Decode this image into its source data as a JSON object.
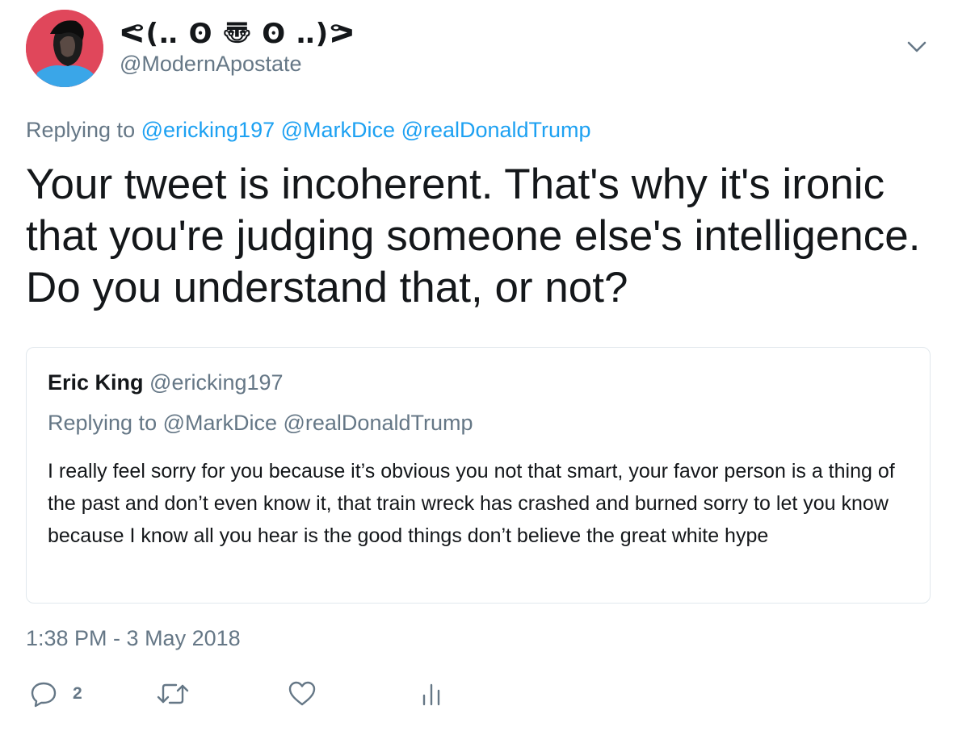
{
  "author": {
    "display_name": "ᕙ(‥ ʘ 〠 ʘ ‥)ᕗ",
    "handle": "@ModernApostate"
  },
  "reply_context": {
    "prefix": "Replying to",
    "mentions": [
      "@ericking197",
      "@MarkDice",
      "@realDonaldTrump"
    ]
  },
  "tweet_text": "Your tweet is incoherent. That's why it's ironic that you're judging someone else's intelligence. Do you understand that, or not?",
  "quoted_tweet": {
    "name": "Eric King",
    "handle": "@ericking197",
    "reply_context": "Replying to @MarkDice @realDonaldTrump",
    "text": "I really feel sorry for you because it’s obvious you not that smart, your favor person is a thing of the past and don’t even know it, that train wreck has crashed and burned sorry to let you know because I know all you hear is the good things don’t believe the great white hype"
  },
  "timestamp": "1:38 PM - 3 May 2018",
  "actions": {
    "reply_count": "2",
    "reply_icon": "reply-icon",
    "retweet_icon": "retweet-icon",
    "like_icon": "heart-icon",
    "analytics_icon": "analytics-icon"
  },
  "colors": {
    "link": "#1da1f2",
    "secondary_text": "#657786",
    "avatar_bg": "#e0475b"
  }
}
